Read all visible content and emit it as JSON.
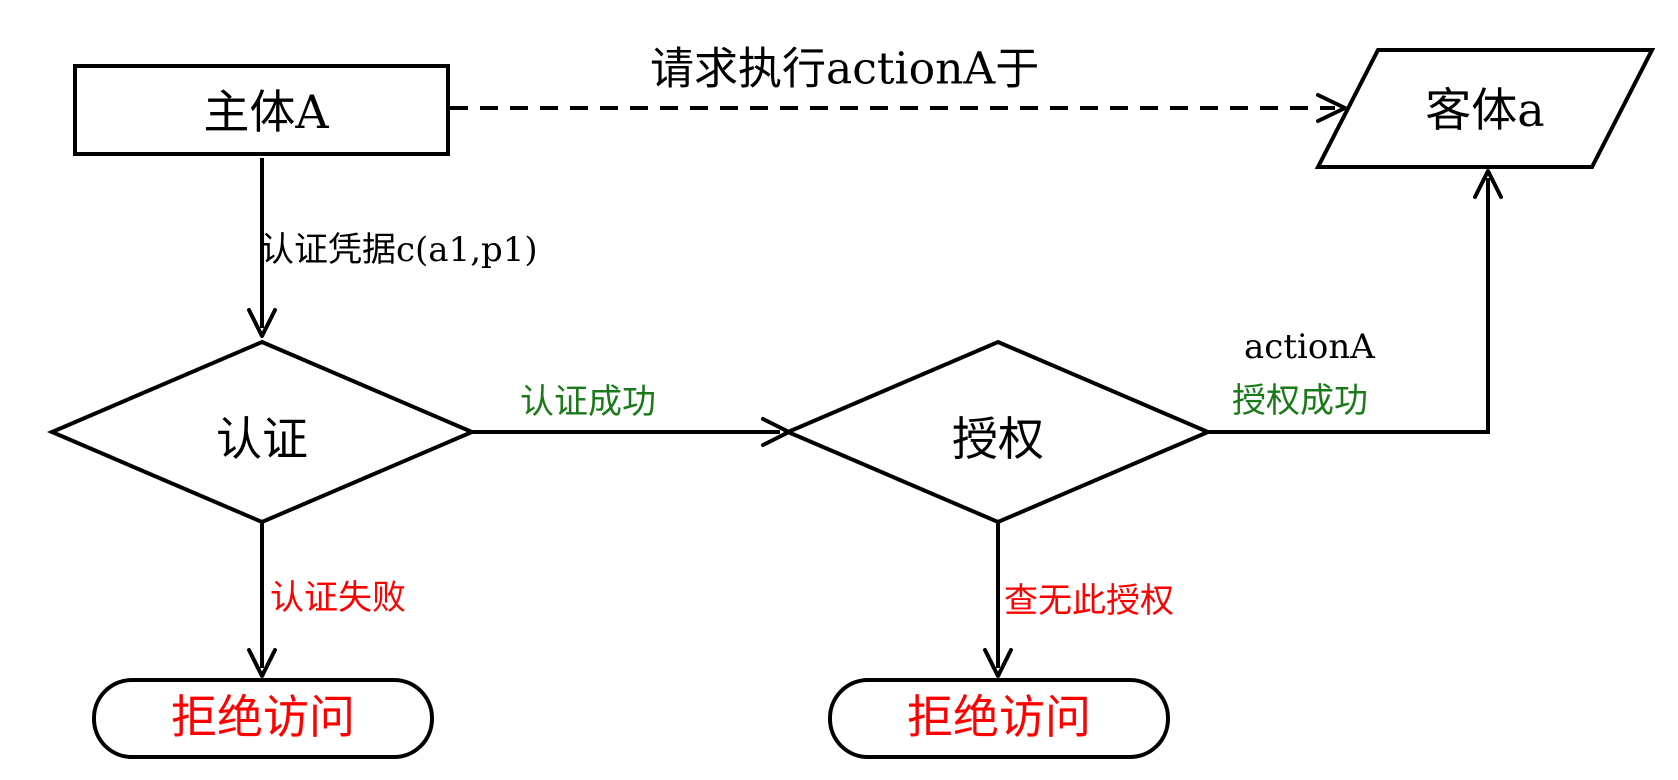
{
  "colors": {
    "success": "#1a7a1a",
    "failure": "#ff0000",
    "default": "#000000"
  },
  "nodes": {
    "subject": "主体A",
    "object": "客体a",
    "authentication": "认证",
    "authorization": "授权",
    "deny_left": "拒绝访问",
    "deny_right": "拒绝访问"
  },
  "edges": {
    "request": "请求执行actionA于",
    "credential": "认证凭据c(a1,p1)",
    "auth_success": "认证成功",
    "auth_failure": "认证失败",
    "action": "actionA",
    "authz_success": "授权成功",
    "authz_none": "查无此授权"
  }
}
